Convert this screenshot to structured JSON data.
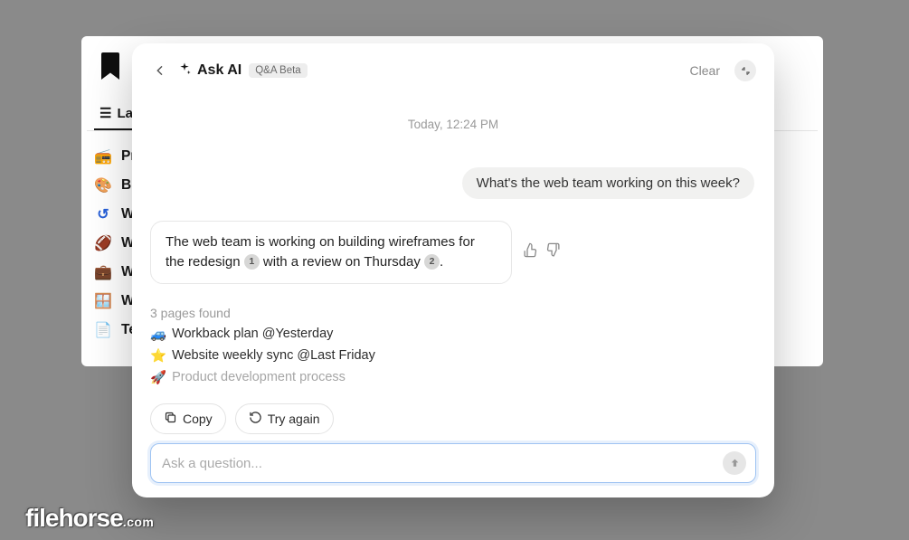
{
  "background": {
    "tab_label": "Lat",
    "items": [
      {
        "icon": "📻",
        "iconClass": "purple",
        "label": "Pro"
      },
      {
        "icon": "🎨",
        "iconClass": "purple",
        "label": "Bra"
      },
      {
        "icon": "↺",
        "iconClass": "blue",
        "label": "We"
      },
      {
        "icon": "🏈",
        "iconClass": "purple",
        "label": "We"
      },
      {
        "icon": "💼",
        "iconClass": "blue",
        "label": "Wo"
      },
      {
        "icon": "🪟",
        "iconClass": "blue",
        "label": "We"
      },
      {
        "icon": "📄",
        "iconClass": "blue",
        "label": "Tec"
      }
    ]
  },
  "modal": {
    "title": "Ask AI",
    "badge": "Q&A Beta",
    "clear_label": "Clear",
    "timestamp": "Today, 12:24 PM",
    "user_message": "What's the web team working on this week?",
    "ai_message_part1": "The web team is working on building wireframes for the redesign ",
    "ai_message_cite1": "1",
    "ai_message_part2": " with a review on Thursday ",
    "ai_message_cite2": "2",
    "ai_message_part3": ".",
    "pages_found_label": "3 pages found",
    "pages": [
      {
        "emoji": "🚙",
        "text": "Workback plan @Yesterday",
        "faded": false
      },
      {
        "emoji": "⭐",
        "text": "Website weekly sync @Last Friday",
        "faded": false
      },
      {
        "emoji": "🚀",
        "text": "Product development process",
        "faded": true
      }
    ],
    "copy_label": "Copy",
    "try_again_label": "Try again",
    "input_placeholder": "Ask a question..."
  },
  "watermark": {
    "main": "filehorse",
    "suffix": ".com"
  }
}
